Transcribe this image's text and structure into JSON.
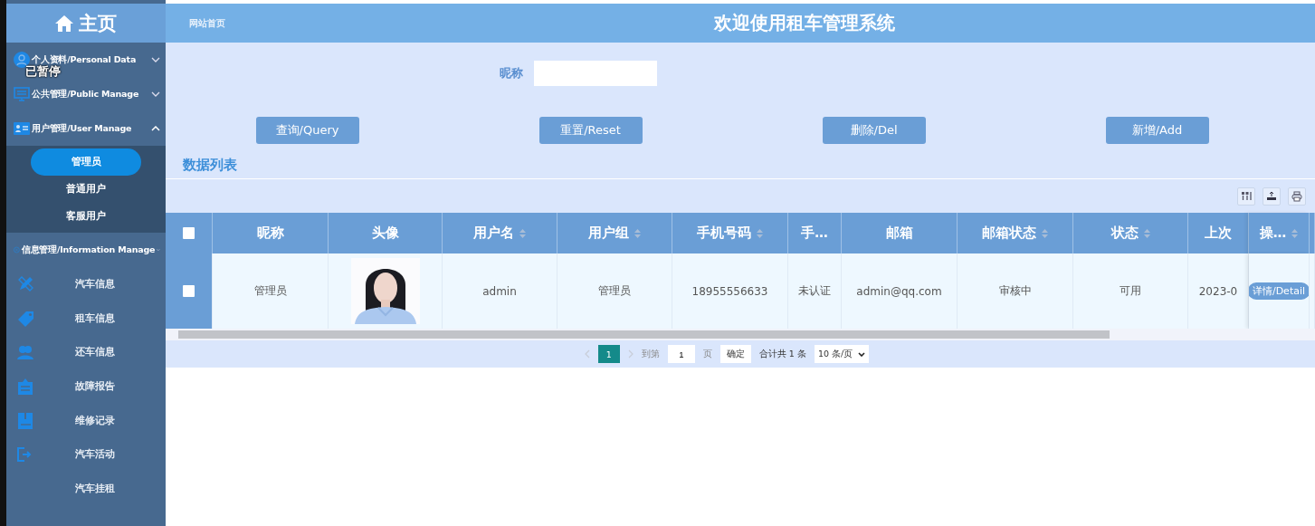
{
  "header": {
    "home_title": "主页",
    "breadcrumb": "网站首页",
    "title": "欢迎使用租车管理系统"
  },
  "overlay": {
    "label": "已暂停"
  },
  "sidebar": {
    "groups": [
      {
        "label": "个人资料/Personal Data",
        "expanded": false
      },
      {
        "label": "公共管理/Public Manage",
        "expanded": false
      },
      {
        "label": "用户管理/User Manage",
        "expanded": true,
        "children": [
          {
            "label": "管理员",
            "selected": true
          },
          {
            "label": "普通用户",
            "selected": false
          },
          {
            "label": "客服用户",
            "selected": false
          }
        ]
      },
      {
        "label": "信息管理/Information Manage",
        "expanded": false,
        "children": [
          {
            "label": "汽车信息",
            "selected": false
          },
          {
            "label": "租车信息",
            "selected": false
          },
          {
            "label": "还车信息",
            "selected": false
          },
          {
            "label": "故障报告",
            "selected": false
          },
          {
            "label": "维修记录",
            "selected": false
          },
          {
            "label": "汽车活动",
            "selected": false
          },
          {
            "label": "汽车挂租",
            "selected": false
          }
        ]
      }
    ]
  },
  "search": {
    "label": "昵称"
  },
  "buttons": [
    "查询/Query",
    "重置/Reset",
    "删除/Del",
    "新增/Add"
  ],
  "section_title": "数据列表",
  "table": {
    "select_all": {
      "checked": false
    },
    "columns": [
      {
        "label": "昵称",
        "sortable": false
      },
      {
        "label": "头像",
        "sortable": false
      },
      {
        "label": "用户名",
        "sortable": true
      },
      {
        "label": "用户组",
        "sortable": true
      },
      {
        "label": "手机号码",
        "sortable": true
      },
      {
        "label": "手…",
        "sortable": false
      },
      {
        "label": "邮箱",
        "sortable": false
      },
      {
        "label": "邮箱状态",
        "sortable": true
      },
      {
        "label": "状态",
        "sortable": true
      },
      {
        "label": "上次",
        "sortable": false
      },
      {
        "label": "操…",
        "sortable": true
      }
    ],
    "rows": [
      {
        "checked": false,
        "cells": [
          "管理员",
          {
            "kind": "picture"
          },
          "admin",
          "管理员",
          "18955556633",
          "未认证",
          "admin@qq.com",
          "审核中",
          "可用",
          "2023-0"
        ],
        "action": "详情/Detail"
      }
    ]
  },
  "pagination": {
    "pages": [
      {
        "label": "1",
        "selected": true
      }
    ],
    "goto_label": "到第",
    "goto_value": "1",
    "page_unit": "页",
    "confirm": "确定",
    "total": "合计共 1 条",
    "page_size": "10 条/页"
  }
}
